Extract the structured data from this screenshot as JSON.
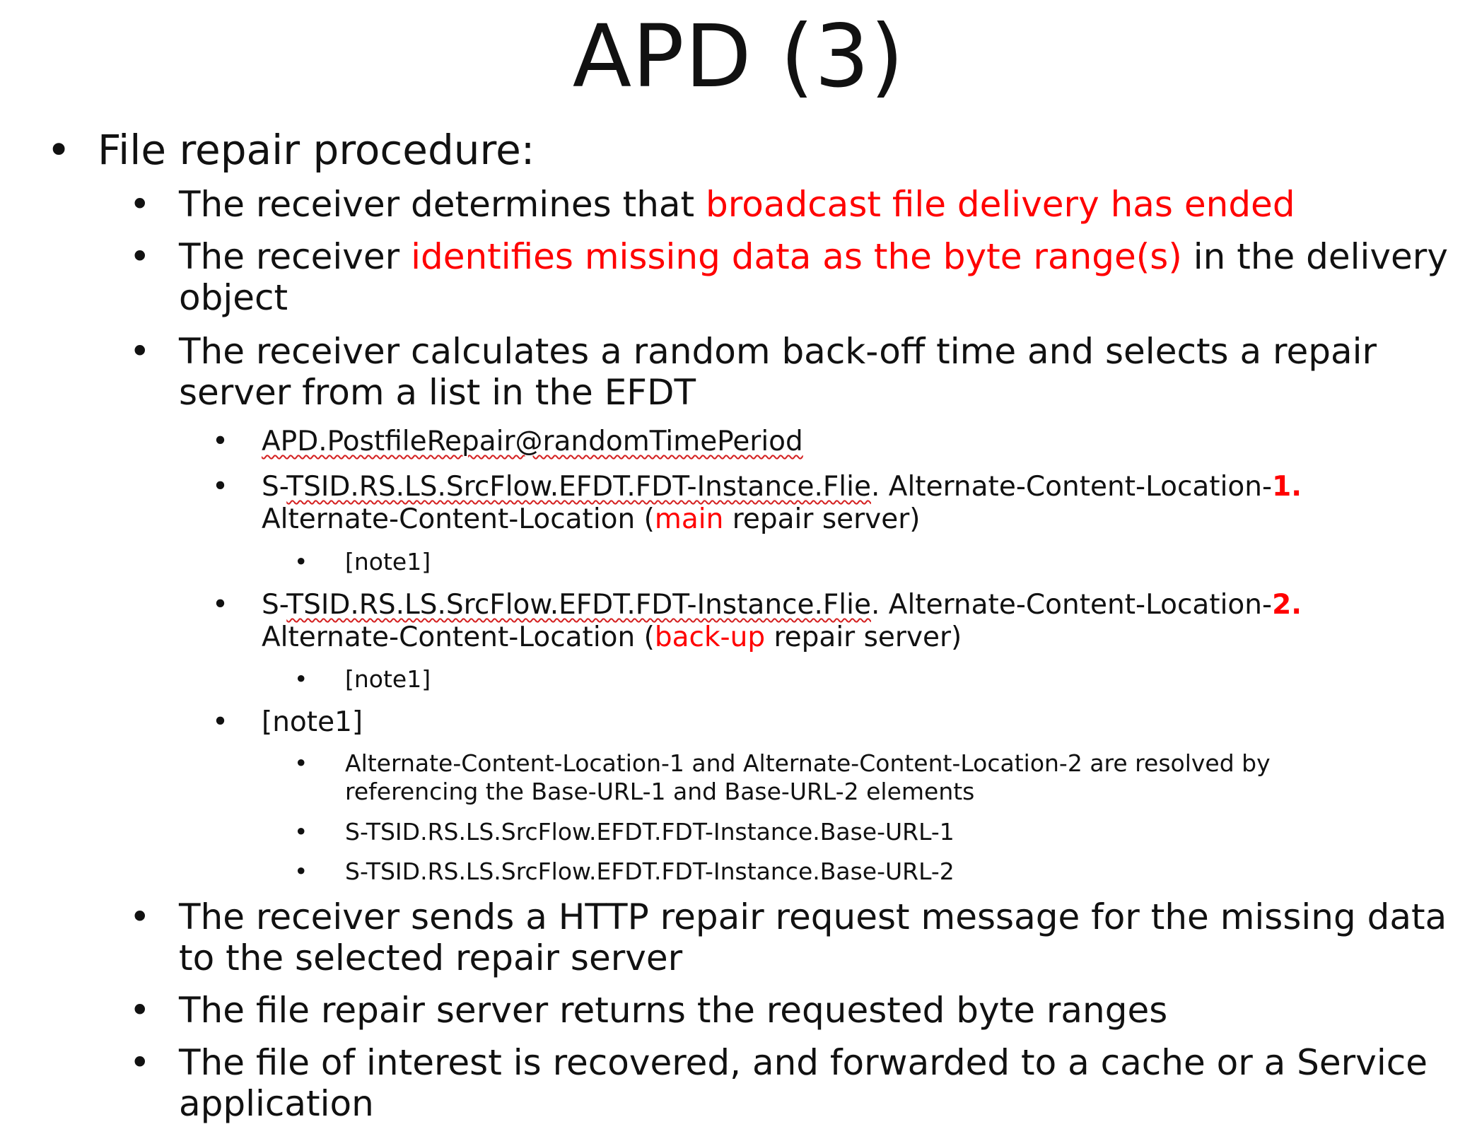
{
  "title": "APD (3)",
  "bullet_glyph": "•",
  "l1": {
    "text": "File repair procedure:"
  },
  "items": {
    "determines": {
      "plain": "The receiver determines that ",
      "red": "broadcast file delivery has ended"
    },
    "identifies": {
      "plain1": "The receiver ",
      "red": "identifies missing data as the byte range(s)",
      "plain2": " in the delivery",
      "line2": "object"
    },
    "calculates": {
      "line1": "The receiver calculates a random back-off time and selects a repair",
      "line2": "server from a list in the EFDT"
    },
    "random_time": "APD.PostfileRepair@randomTimePeriod",
    "acl1": {
      "prefix": "S-",
      "path": "TSID.RS.LS.SrcFlow.EFDT.FDT-Instance.Flie",
      "suffix": ". Alternate-Content-Location-",
      "num": "1.",
      "line2_a": "Alternate-Content-Location (",
      "line2_red": "main",
      "line2_b": " repair server)"
    },
    "note_a": "[note1]",
    "acl2": {
      "prefix": "S-",
      "path": "TSID.RS.LS.SrcFlow.EFDT.FDT-Instance.Flie",
      "suffix": ". Alternate-Content-Location-",
      "num": "2.",
      "line2_a": "Alternate-Content-Location (",
      "line2_red": "back-up",
      "line2_b": " repair server)"
    },
    "note_b": "[note1]",
    "note1": "[note1]",
    "note1_resolved": {
      "line1": "Alternate-Content-Location-1  and Alternate-Content-Location-2  are resolved by",
      "line2": "referencing  the Base-URL-1 and Base-URL-2  elements"
    },
    "base_url_1": "S-TSID.RS.LS.SrcFlow.EFDT.FDT-Instance.Base-URL-1",
    "base_url_2": "S-TSID.RS.LS.SrcFlow.EFDT.FDT-Instance.Base-URL-2",
    "sends": {
      "line1": "The receiver sends a HTTP repair request message for the missing data",
      "line2": "to the selected repair server"
    },
    "returns": "The file repair server returns the requested byte ranges",
    "recovered": {
      "line1": "The file of interest is recovered, and forwarded to a cache or a Service",
      "line2": "application"
    }
  },
  "colors": {
    "text": "#111111",
    "highlight": "#ff0000",
    "spellcheck": "#d42020"
  }
}
